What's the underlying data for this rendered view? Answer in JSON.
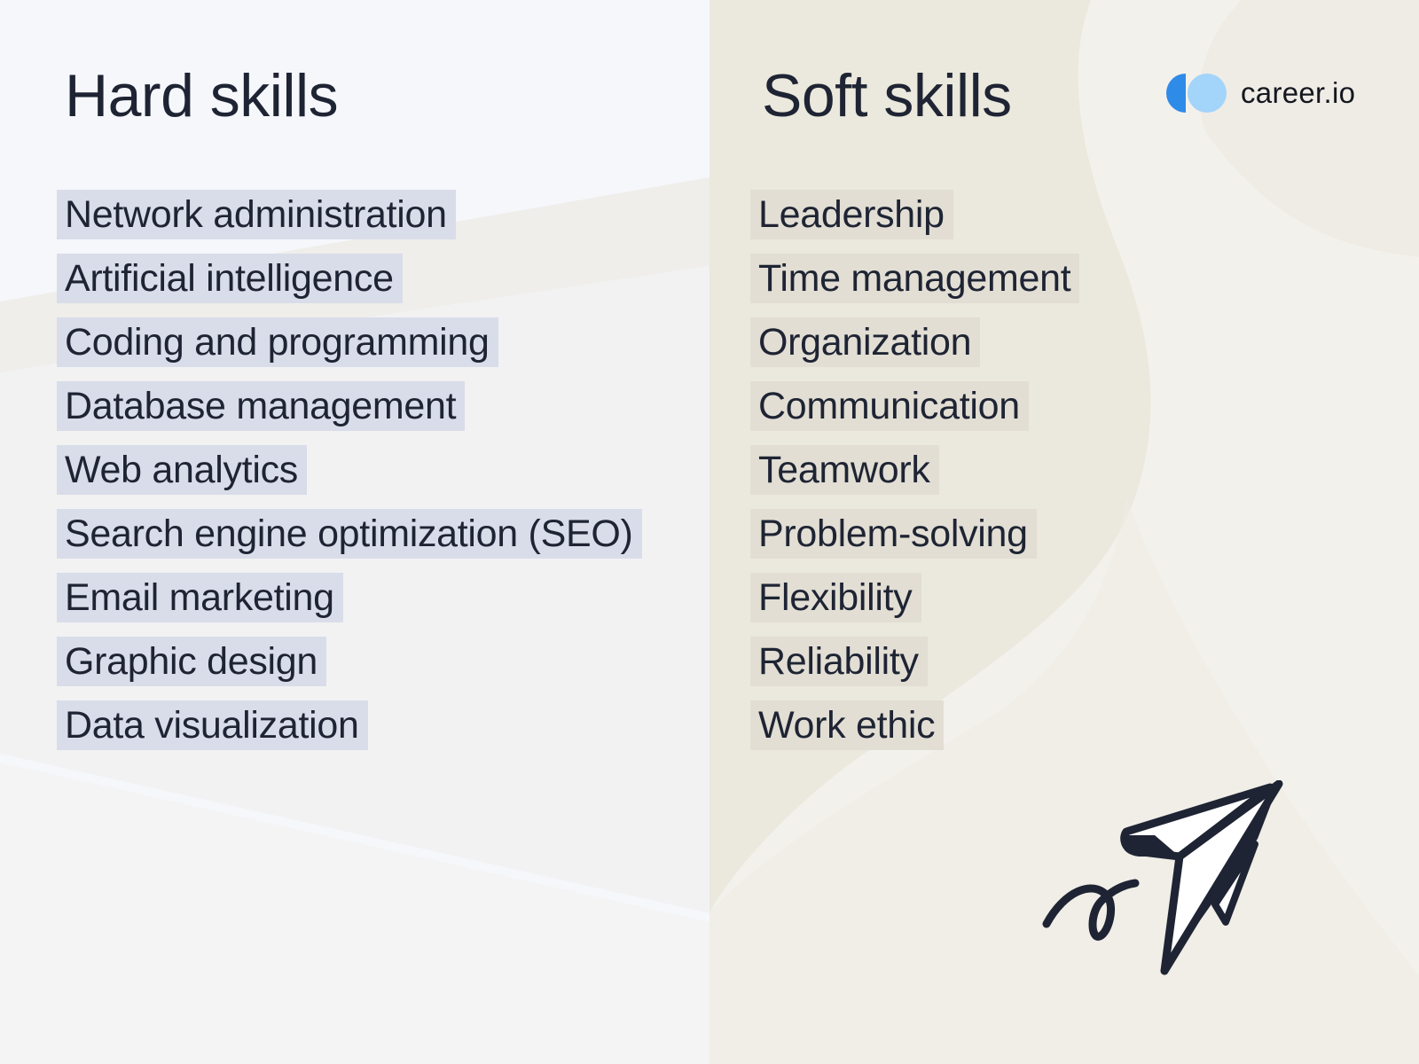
{
  "hard_skills": {
    "title": "Hard skills",
    "items": [
      "Network administration",
      "Artificial intelligence",
      "Coding and programming",
      "Database management",
      "Web analytics",
      "Search engine optimization (SEO)",
      "Email marketing",
      "Graphic design",
      "Data visualization"
    ]
  },
  "soft_skills": {
    "title": "Soft skills",
    "items": [
      "Leadership",
      "Time management",
      "Organization",
      "Communication",
      "Teamwork",
      "Problem-solving",
      "Flexibility",
      "Reliability",
      "Work ethic"
    ]
  },
  "brand": {
    "name": "career.io",
    "logo_icon": "two-circle-logo-icon",
    "colors": {
      "primary": "#2f8be8",
      "secondary": "#a3d4fa"
    }
  },
  "illustration": {
    "icon": "paper-plane-icon"
  },
  "colors": {
    "text": "#1e2433",
    "hard_bg": "#f6f7fb",
    "hard_chip": "#d9dde9",
    "soft_bg": "#f3f1ec",
    "soft_chip": "#e2ded4"
  }
}
